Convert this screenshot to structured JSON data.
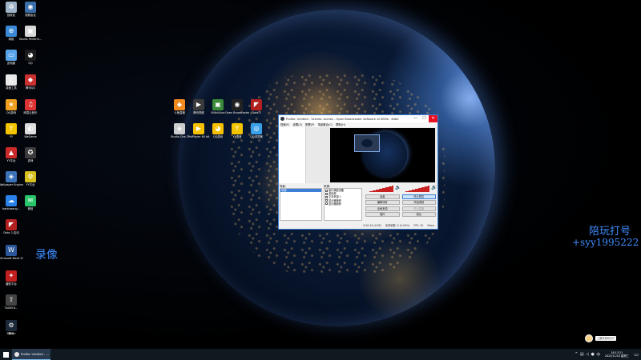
{
  "desktop_icons": [
    {
      "id": "recycle",
      "label": "回收站",
      "icon": "recycle-bin-icon",
      "color": "#9fb4c8",
      "glyph": "♻"
    },
    {
      "id": "wired",
      "label": "视频会议",
      "icon": "network-icon",
      "color": "#3a6ea8",
      "glyph": "◉"
    },
    {
      "id": "net",
      "label": "网络",
      "icon": "network-globe-icon",
      "color": "#3a8ad8",
      "glyph": "⊕"
    },
    {
      "id": "studio",
      "label": "Studio Perform...",
      "icon": "studio-icon",
      "color": "#d7d7d7",
      "glyph": "▣"
    },
    {
      "id": "computer",
      "label": "此电脑",
      "icon": "computer-icon",
      "color": "#56a3e8",
      "glyph": "▭"
    },
    {
      "id": "bird",
      "label": "QQ",
      "icon": "penguin-icon",
      "color": "#1b1b1b",
      "glyph": "◕"
    },
    {
      "id": "cp",
      "label": "桌面工具",
      "icon": "tool-icon",
      "color": "#e8e8e8",
      "glyph": "▯"
    },
    {
      "id": "mk",
      "label": "腾讯QQ",
      "icon": "game-icon",
      "color": "#c93030",
      "glyph": "◆"
    },
    {
      "id": "qq",
      "label": "QQ游戏",
      "icon": "qq-game-icon",
      "color": "#f0a020",
      "glyph": "★"
    },
    {
      "id": "netease",
      "label": "网易云音乐",
      "icon": "music-icon",
      "color": "#d33",
      "glyph": "♫"
    },
    {
      "id": "yy",
      "label": "YY",
      "icon": "yy-icon",
      "color": "#f5c400",
      "glyph": "Y"
    },
    {
      "id": "wegame",
      "label": "WeGame",
      "icon": "wegame-icon",
      "color": "#ddd",
      "glyph": "◐"
    },
    {
      "id": "yyplat",
      "label": "YY平台",
      "icon": "game-pad-icon",
      "color": "#cc2a2a",
      "glyph": "▲"
    },
    {
      "id": "steam2",
      "label": "游戏",
      "icon": "app-icon",
      "color": "#3c3c3c",
      "glyph": "✪"
    },
    {
      "id": "wallpaper",
      "label": "Wallpaper Engine",
      "icon": "wallpaper-icon",
      "color": "#3b72b8",
      "glyph": "◈"
    },
    {
      "id": "cs",
      "label": "YY平台",
      "icon": "gear-icon",
      "color": "#d8c020",
      "glyph": "⚙"
    },
    {
      "id": "baidu",
      "label": "baiduwang...",
      "icon": "baidu-icon",
      "color": "#2a82e8",
      "glyph": "☁"
    },
    {
      "id": "wechat",
      "label": "微信",
      "icon": "wechat-icon",
      "color": "#2ac56a",
      "glyph": "✉"
    },
    {
      "id": "dota",
      "label": "Dota 2 启动",
      "icon": "dota-icon",
      "color": "#b42020",
      "glyph": "◤"
    },
    {
      "id": "word",
      "label": "Microsoft Word 2016",
      "icon": "word-icon",
      "color": "#2b579a",
      "glyph": "W"
    },
    {
      "id": "mouse",
      "label": "雷蛇平台",
      "icon": "razer-icon",
      "color": "#c02020",
      "glyph": "✦"
    },
    {
      "id": "tagin",
      "label": "TAGIN 6...",
      "icon": "app-tile-icon",
      "color": "#444",
      "glyph": "⇧"
    },
    {
      "id": "pr",
      "label": "腾讯",
      "icon": "pr-icon",
      "color": "#5b47d6",
      "glyph": "P"
    },
    {
      "id": "steam",
      "label": "Steam",
      "icon": "steam-icon",
      "color": "#1b2838",
      "glyph": "⚙"
    }
  ],
  "cluster_icons": [
    {
      "label": "斗鱼直播",
      "icon": "douyu-icon",
      "color": "#f08a20",
      "glyph": "◆"
    },
    {
      "label": "腾讯视频",
      "icon": "video-icon",
      "color": "#3a3a3a",
      "glyph": "▶"
    },
    {
      "label": "BilibiliLive",
      "icon": "bilibili-icon",
      "color": "#3a8a3a",
      "glyph": "▣"
    },
    {
      "label": "Open Broadcaster",
      "icon": "obs-icon",
      "color": "#222",
      "glyph": "◉"
    },
    {
      "label": "Dota 2",
      "icon": "dota-icon",
      "color": "#b42020",
      "glyph": "◤"
    },
    {
      "label": "Studio One 2",
      "icon": "studio-one-icon",
      "color": "#ccc",
      "glyph": "◈"
    },
    {
      "label": "PotPlayer 64 bit",
      "icon": "potplayer-icon",
      "color": "#f5c000",
      "glyph": "▶"
    },
    {
      "label": "QQ游戏",
      "icon": "qq-icon",
      "color": "#f5c000",
      "glyph": "◕"
    },
    {
      "label": "YY语音",
      "icon": "yy-icon",
      "color": "#f5c400",
      "glyph": "Y"
    },
    {
      "label": "QQ浏览器",
      "icon": "browser-icon",
      "color": "#3aa0e8",
      "glyph": "◎"
    }
  ],
  "overlay": {
    "record": "录像",
    "escort_title": "陪玩打号",
    "escort_id": "+syy1995222"
  },
  "obs": {
    "title": "Profile: Untitled - Scenes: scenes - Open Broadcaster Software v0.659b - 64bit",
    "menu": [
      "档案(F)",
      "设置(S)",
      "配置(P)",
      "场景集合(C)",
      "帮助(H)"
    ],
    "scenes_label": "场景:",
    "scene_items": [
      "场景"
    ],
    "sources_label": "来源:",
    "source_items": [
      "窗口捕捉设备",
      "游戏源",
      "文本来源 1",
      "显示器捕获",
      "显示器捕获"
    ],
    "buttons": [
      {
        "label": "设置",
        "state": "normal"
      },
      {
        "label": "停止预览",
        "state": "active"
      },
      {
        "label": "编辑场景",
        "state": "normal"
      },
      {
        "label": "开始录制",
        "state": "normal"
      },
      {
        "label": "全局来源",
        "state": "normal"
      },
      {
        "label": "停止直播",
        "state": "disabled"
      },
      {
        "label": "插件",
        "state": "normal"
      },
      {
        "label": "退出",
        "state": "normal"
      }
    ],
    "status": [
      "0:00:16 (LIVE)",
      "丢弃帧数: 0 (0.00%)",
      "FPS: 30",
      "0kb/s"
    ]
  },
  "taskbar": {
    "obs_task": "Profile: Untitled - ...",
    "clock_time": "16:13:21",
    "clock_date": "2022/11/16 星期三"
  },
  "widget": {
    "bubble": "三国杀游戏大厅"
  }
}
